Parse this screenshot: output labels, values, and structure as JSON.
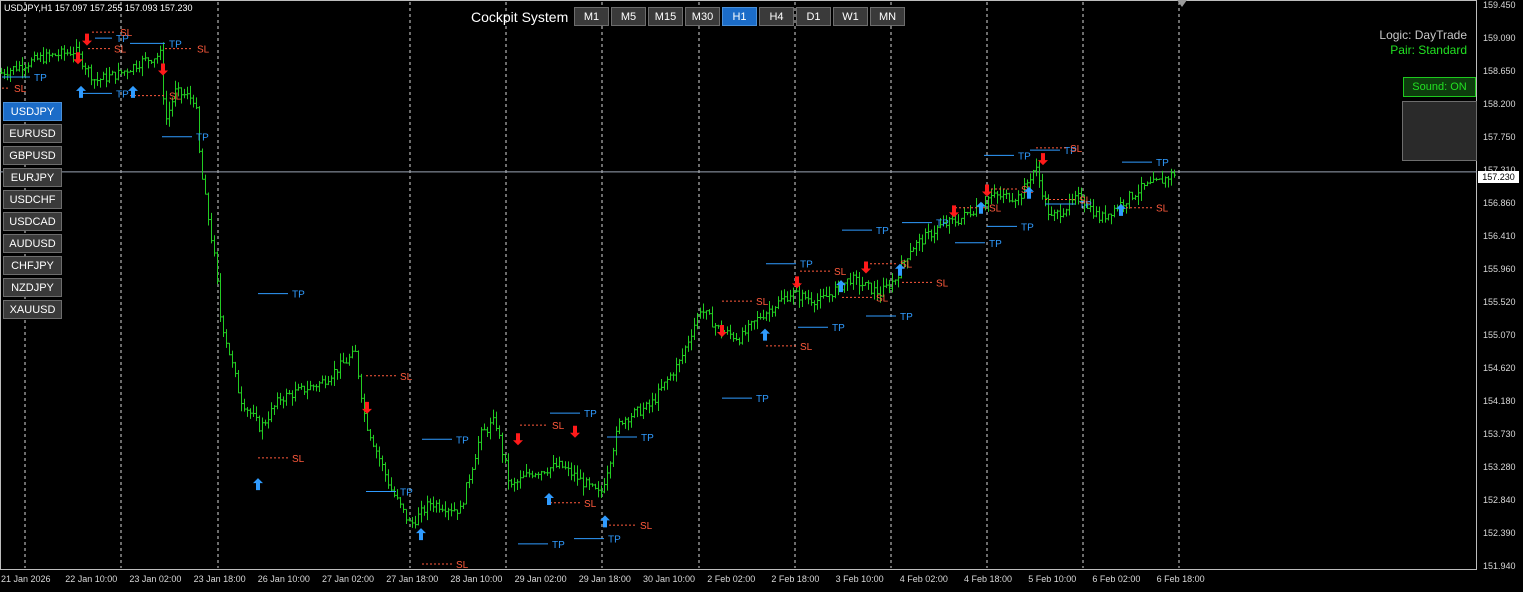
{
  "header": {
    "symbol_info": "USDJPY,H1  157.097 157.255 157.093 157.230"
  },
  "panel": {
    "title": "Cockpit System",
    "timeframes": [
      "M1",
      "M5",
      "M15",
      "M30",
      "H1",
      "H4",
      "D1",
      "W1",
      "MN"
    ],
    "active_timeframe": "H1",
    "symbols": [
      "USDJPY",
      "EURUSD",
      "GBPUSD",
      "EURJPY",
      "USDCHF",
      "USDCAD",
      "AUDUSD",
      "CHFJPY",
      "NZDJPY",
      "XAUUSD"
    ],
    "active_symbol": "USDJPY",
    "logic_text": "Logic: DayTrade",
    "pair_text": "Pair: Standard",
    "sound_label": "Sound: ON"
  },
  "price_axis": {
    "labels": [
      "159.450",
      "159.090",
      "158.650",
      "158.200",
      "157.750",
      "157.310",
      "156.860",
      "156.410",
      "155.960",
      "155.520",
      "155.070",
      "154.620",
      "154.180",
      "153.730",
      "153.280",
      "152.840",
      "152.390",
      "151.940"
    ],
    "current_price": "157.230"
  },
  "time_axis": {
    "labels": [
      "21 Jan 2026",
      "22 Jan 10:00",
      "23 Jan 02:00",
      "23 Jan 18:00",
      "26 Jan 10:00",
      "27 Jan 02:00",
      "27 Jan 18:00",
      "28 Jan 10:00",
      "29 Jan 02:00",
      "29 Jan 18:00",
      "30 Jan 10:00",
      "2 Feb 02:00",
      "2 Feb 18:00",
      "3 Feb 10:00",
      "4 Feb 02:00",
      "4 Feb 18:00",
      "5 Feb 10:00",
      "6 Feb 02:00",
      "6 Feb 18:00"
    ]
  },
  "levels": {
    "tp_label": "TP",
    "sl_label": "SL"
  },
  "colors": {
    "candle": "#22cc22",
    "tp": "#2f9bff",
    "sl": "#ff5a3c",
    "arrow_up": "#2f9bff",
    "arrow_down": "#ff1a1a",
    "grid": "#ffffff",
    "price_line": "#9aa4b4"
  },
  "chart_data": {
    "type": "ohlc",
    "instrument": "USDJPY",
    "timeframe": "H1",
    "y_range": [
      151.94,
      159.45
    ],
    "last_close": 157.23,
    "path": [
      [
        0,
        158.55
      ],
      [
        40,
        158.75
      ],
      [
        75,
        158.85
      ],
      [
        95,
        158.45
      ],
      [
        120,
        158.55
      ],
      [
        140,
        158.7
      ],
      [
        160,
        158.8
      ],
      [
        165,
        157.9
      ],
      [
        175,
        158.3
      ],
      [
        195,
        158.2
      ],
      [
        200,
        157.3
      ],
      [
        215,
        156.0
      ],
      [
        220,
        155.3
      ],
      [
        240,
        154.2
      ],
      [
        260,
        153.8
      ],
      [
        280,
        154.2
      ],
      [
        320,
        154.4
      ],
      [
        355,
        154.8
      ],
      [
        365,
        153.9
      ],
      [
        390,
        153.0
      ],
      [
        410,
        152.5
      ],
      [
        430,
        152.8
      ],
      [
        460,
        152.7
      ],
      [
        480,
        153.7
      ],
      [
        495,
        153.9
      ],
      [
        510,
        153.0
      ],
      [
        530,
        153.2
      ],
      [
        560,
        153.3
      ],
      [
        600,
        152.9
      ],
      [
        620,
        153.9
      ],
      [
        650,
        154.1
      ],
      [
        680,
        154.7
      ],
      [
        700,
        155.4
      ],
      [
        720,
        155.1
      ],
      [
        740,
        155.0
      ],
      [
        760,
        155.3
      ],
      [
        790,
        155.6
      ],
      [
        820,
        155.5
      ],
      [
        850,
        155.8
      ],
      [
        880,
        155.6
      ],
      [
        895,
        155.8
      ],
      [
        910,
        156.2
      ],
      [
        940,
        156.5
      ],
      [
        960,
        156.6
      ],
      [
        990,
        156.9
      ],
      [
        1020,
        156.9
      ],
      [
        1035,
        157.3
      ],
      [
        1050,
        156.6
      ],
      [
        1080,
        156.9
      ],
      [
        1100,
        156.6
      ],
      [
        1120,
        156.8
      ],
      [
        1140,
        157.0
      ],
      [
        1160,
        157.1
      ],
      [
        1176,
        157.23
      ]
    ],
    "tp_levels": [
      {
        "x0": 95,
        "x1": 112,
        "price": 159.02
      },
      {
        "x0": 2,
        "x1": 30,
        "price": 158.5
      },
      {
        "x0": 80,
        "x1": 112,
        "price": 158.28
      },
      {
        "x0": 130,
        "x1": 165,
        "price": 158.95
      },
      {
        "x0": 162,
        "x1": 192,
        "price": 157.7
      },
      {
        "x0": 258,
        "x1": 288,
        "price": 155.6
      },
      {
        "x0": 366,
        "x1": 396,
        "price": 152.95
      },
      {
        "x0": 422,
        "x1": 452,
        "price": 153.65
      },
      {
        "x0": 518,
        "x1": 548,
        "price": 152.25
      },
      {
        "x0": 550,
        "x1": 580,
        "price": 154.0
      },
      {
        "x0": 574,
        "x1": 604,
        "price": 152.32
      },
      {
        "x0": 607,
        "x1": 637,
        "price": 153.68
      },
      {
        "x0": 722,
        "x1": 752,
        "price": 154.2
      },
      {
        "x0": 766,
        "x1": 796,
        "price": 156.0
      },
      {
        "x0": 798,
        "x1": 828,
        "price": 155.15
      },
      {
        "x0": 842,
        "x1": 872,
        "price": 156.45
      },
      {
        "x0": 866,
        "x1": 896,
        "price": 155.3
      },
      {
        "x0": 902,
        "x1": 932,
        "price": 156.55
      },
      {
        "x0": 955,
        "x1": 985,
        "price": 156.28
      },
      {
        "x0": 987,
        "x1": 1017,
        "price": 156.5
      },
      {
        "x0": 984,
        "x1": 1014,
        "price": 157.45
      },
      {
        "x0": 1030,
        "x1": 1060,
        "price": 157.52
      },
      {
        "x0": 1045,
        "x1": 1075,
        "price": 156.8
      },
      {
        "x0": 1122,
        "x1": 1152,
        "price": 157.36
      }
    ],
    "sl_levels": [
      {
        "x0": 92,
        "x1": 116,
        "price": 159.1
      },
      {
        "x0": 88,
        "x1": 110,
        "price": 158.88
      },
      {
        "x0": 165,
        "x1": 193,
        "price": 158.88
      },
      {
        "x0": 2,
        "x1": 10,
        "price": 158.35
      },
      {
        "x0": 130,
        "x1": 165,
        "price": 158.25
      },
      {
        "x0": 258,
        "x1": 288,
        "price": 153.4
      },
      {
        "x0": 366,
        "x1": 396,
        "price": 154.5
      },
      {
        "x0": 422,
        "x1": 452,
        "price": 151.98
      },
      {
        "x0": 520,
        "x1": 548,
        "price": 153.84
      },
      {
        "x0": 550,
        "x1": 580,
        "price": 152.8
      },
      {
        "x0": 605,
        "x1": 636,
        "price": 152.5
      },
      {
        "x0": 722,
        "x1": 752,
        "price": 155.5
      },
      {
        "x0": 766,
        "x1": 796,
        "price": 154.9
      },
      {
        "x0": 800,
        "x1": 830,
        "price": 155.9
      },
      {
        "x0": 842,
        "x1": 872,
        "price": 155.55
      },
      {
        "x0": 866,
        "x1": 896,
        "price": 156.0
      },
      {
        "x0": 902,
        "x1": 932,
        "price": 155.75
      },
      {
        "x0": 955,
        "x1": 985,
        "price": 156.75
      },
      {
        "x0": 987,
        "x1": 1017,
        "price": 157.0
      },
      {
        "x0": 1036,
        "x1": 1066,
        "price": 157.55
      },
      {
        "x0": 1045,
        "x1": 1075,
        "price": 156.86
      },
      {
        "x0": 1122,
        "x1": 1152,
        "price": 156.75
      }
    ],
    "arrows": [
      {
        "dir": "down",
        "x": 87,
        "price": 159.0
      },
      {
        "dir": "down",
        "x": 78,
        "price": 158.75
      },
      {
        "dir": "up",
        "x": 81,
        "price": 158.3
      },
      {
        "dir": "up",
        "x": 133,
        "price": 158.3
      },
      {
        "dir": "down",
        "x": 163,
        "price": 158.6
      },
      {
        "dir": "up",
        "x": 258,
        "price": 153.05
      },
      {
        "dir": "down",
        "x": 367,
        "price": 154.07
      },
      {
        "dir": "up",
        "x": 421,
        "price": 152.38
      },
      {
        "dir": "down",
        "x": 518,
        "price": 153.65
      },
      {
        "dir": "down",
        "x": 575,
        "price": 153.75
      },
      {
        "dir": "up",
        "x": 549,
        "price": 152.85
      },
      {
        "dir": "up",
        "x": 605,
        "price": 152.55
      },
      {
        "dir": "down",
        "x": 722,
        "price": 155.1
      },
      {
        "dir": "up",
        "x": 765,
        "price": 155.05
      },
      {
        "dir": "down",
        "x": 797,
        "price": 155.75
      },
      {
        "dir": "up",
        "x": 841,
        "price": 155.7
      },
      {
        "dir": "down",
        "x": 866,
        "price": 155.95
      },
      {
        "dir": "up",
        "x": 900,
        "price": 155.92
      },
      {
        "dir": "down",
        "x": 954,
        "price": 156.7
      },
      {
        "dir": "up",
        "x": 981,
        "price": 156.75
      },
      {
        "dir": "down",
        "x": 987,
        "price": 156.98
      },
      {
        "dir": "up",
        "x": 1029,
        "price": 156.95
      },
      {
        "dir": "down",
        "x": 1043,
        "price": 157.4
      },
      {
        "dir": "up",
        "x": 1121,
        "price": 156.72
      }
    ]
  }
}
